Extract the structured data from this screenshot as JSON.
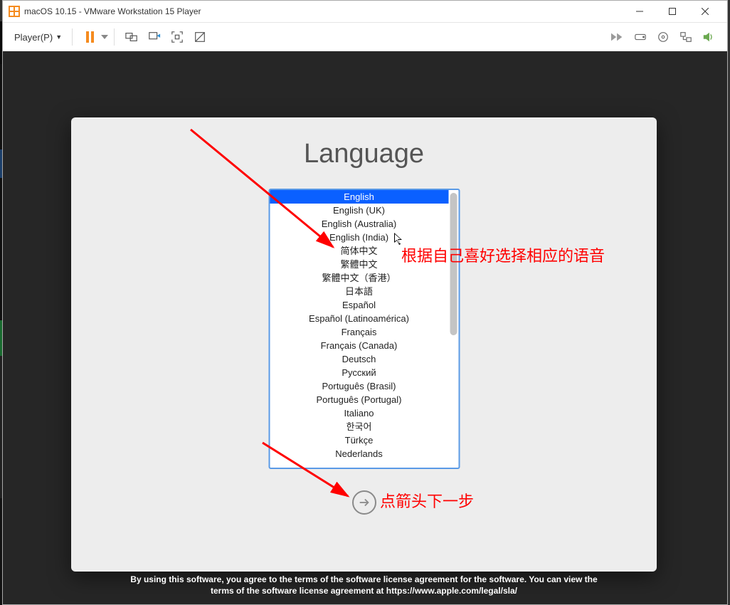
{
  "window": {
    "title": "macOS 10.15 - VMware Workstation 15 Player"
  },
  "toolbar": {
    "player_label": "Player(P)"
  },
  "recovery": {
    "title": "Language",
    "languages": [
      "English",
      "English (UK)",
      "English (Australia)",
      "English (India)",
      "简体中文",
      "繁體中文",
      "繁體中文（香港）",
      "日本語",
      "Español",
      "Español (Latinoamérica)",
      "Français",
      "Français (Canada)",
      "Deutsch",
      "Русский",
      "Português (Brasil)",
      "Português (Portugal)",
      "Italiano",
      "한국어",
      "Türkçe",
      "Nederlands"
    ],
    "selected_index": 0,
    "footer_line1": "By using this software, you agree to the terms of the software license agreement for the software. You can view the",
    "footer_line2": "terms of the software license agreement at https://www.apple.com/legal/sla/"
  },
  "annotations": {
    "lang_hint": "根据自己喜好选择相应的语音",
    "next_hint": "点箭头下一步"
  }
}
